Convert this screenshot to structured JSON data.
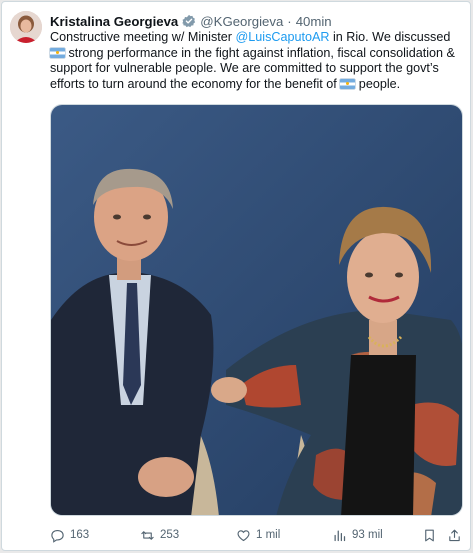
{
  "author": {
    "name": "Kristalina Georgieva",
    "handle": "@KGeorgieva",
    "separator": "·",
    "time": "40min"
  },
  "tweet": {
    "text_1": "Constructive meeting w/ Minister ",
    "mention": "@LuisCaputoAR",
    "text_2": " in Rio. We discussed ",
    "text_3": " strong performance in the fight against inflation, fiscal consolidation & support for vulnerable people. We are committed to support the govt’s efforts to turn around the economy for the benefit of ",
    "text_4": " people."
  },
  "actions": {
    "replies": "163",
    "reposts": "253",
    "likes": "1 mil",
    "views": "93 mil"
  },
  "icons": {
    "verified": "verified-badge-icon",
    "flag": "argentina-flag-icon",
    "reply": "reply-icon",
    "repost": "repost-icon",
    "like": "heart-icon",
    "views": "views-chart-icon",
    "bookmark": "bookmark-icon",
    "share": "share-icon"
  },
  "colors": {
    "link": "#1d9bf0",
    "muted": "#536471",
    "verified": "#829aab",
    "photo_background": "#2f4c74"
  }
}
